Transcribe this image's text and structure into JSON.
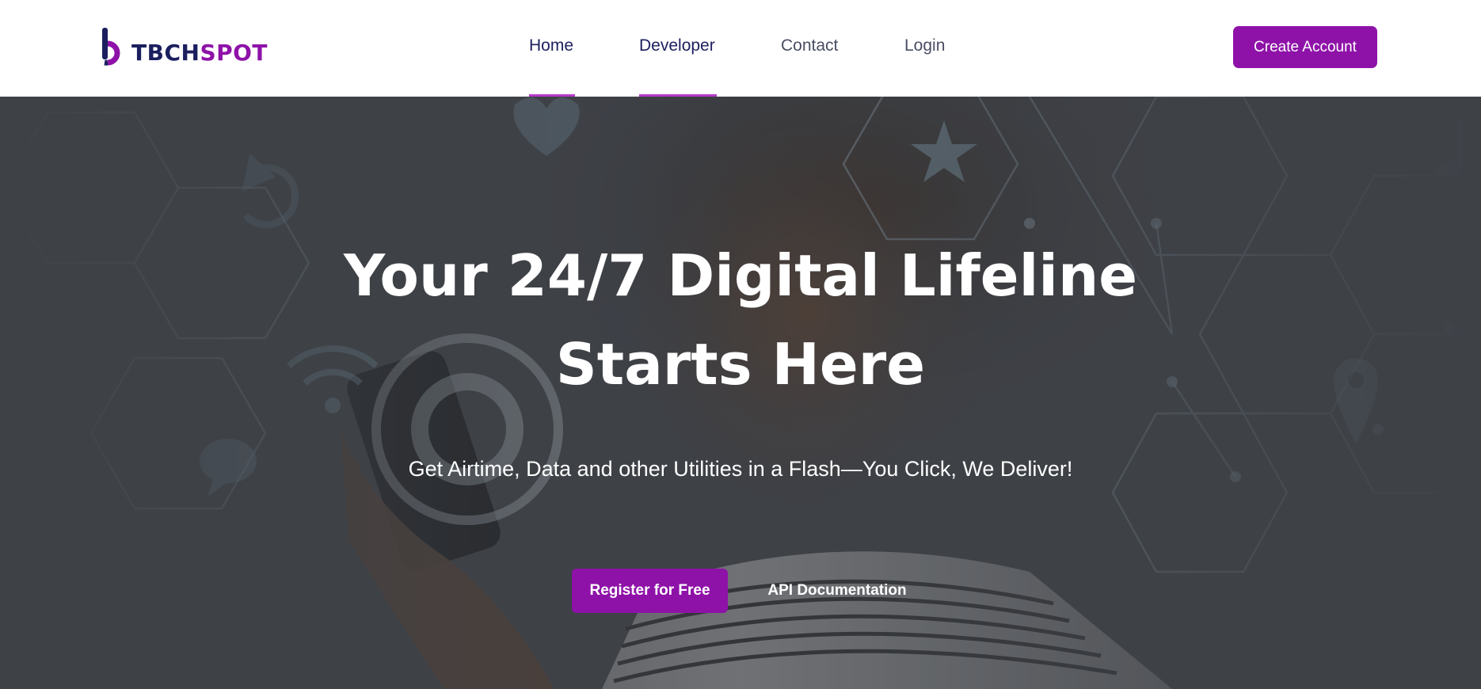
{
  "header": {
    "logo": {
      "text_part1": "TBCH",
      "text_part2": "SPOT",
      "mark_icon": "logo-b-mark"
    },
    "nav": [
      {
        "label": "Home",
        "active": true
      },
      {
        "label": "Developer",
        "active": true
      },
      {
        "label": "Contact",
        "active": false
      },
      {
        "label": "Login",
        "active": false
      }
    ],
    "create_account_label": "Create Account"
  },
  "hero": {
    "title_line1": "Your 24/7 Digital Lifeline",
    "title_line2": "Starts Here",
    "subtitle": "Get Airtime, Data and other Utilities in a Flash—You Click, We Deliver!",
    "register_label": "Register for Free",
    "api_docs_label": "API Documentation",
    "background_icons": [
      "star-icon",
      "music-note-icon",
      "location-pin-icon",
      "wifi-icon",
      "chat-bubble-icon",
      "refresh-icon",
      "heart-icon"
    ]
  },
  "colors": {
    "brand_purple": "#8e12a8",
    "brand_navy": "#1b1f5e",
    "nav_underline": "#b53bc9",
    "hero_overlay": "#3f4248"
  }
}
